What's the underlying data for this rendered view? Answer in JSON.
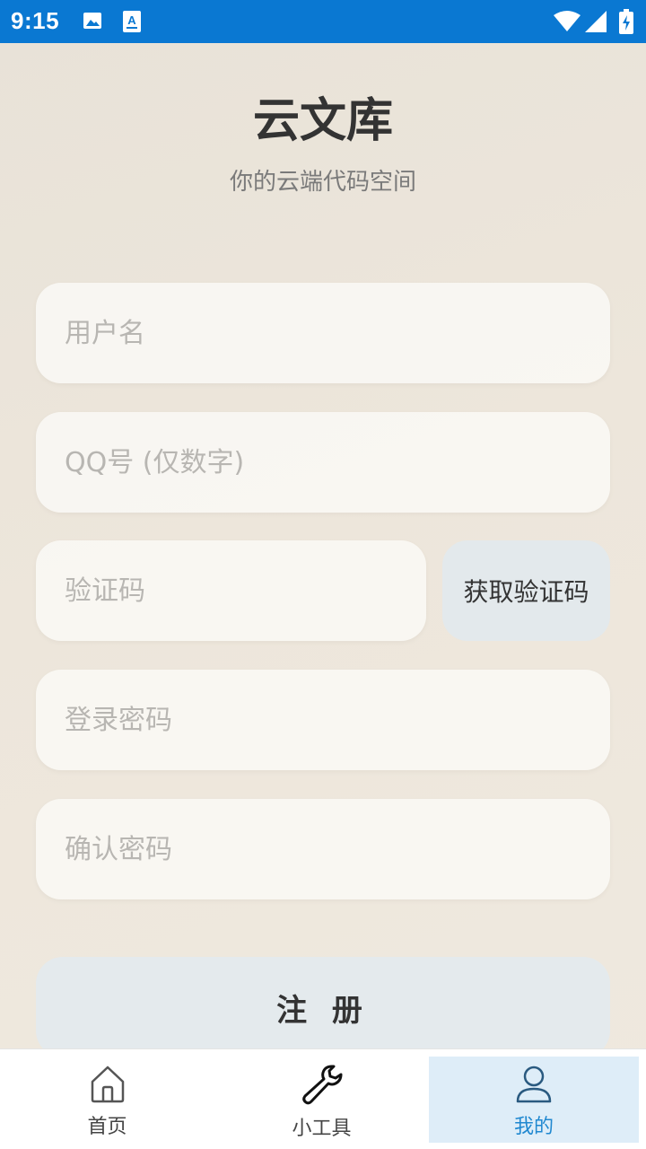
{
  "status_bar": {
    "time": "9:15",
    "background": "#0a78d2"
  },
  "header": {
    "title": "云文库",
    "subtitle": "你的云端代码空间"
  },
  "form": {
    "username_placeholder": "用户名",
    "qq_placeholder": "QQ号 (仅数字)",
    "code_placeholder": "验证码",
    "get_code_label": "获取验证码",
    "password_placeholder": "登录密码",
    "confirm_password_placeholder": "确认密码",
    "register_label": "注 册"
  },
  "bottom_nav": {
    "items": [
      {
        "label": "首页",
        "icon": "home-icon",
        "active": false
      },
      {
        "label": "小工具",
        "icon": "wrench-icon",
        "active": false
      },
      {
        "label": "我的",
        "icon": "user-icon",
        "active": true
      }
    ],
    "active_color": "#2088d0"
  }
}
